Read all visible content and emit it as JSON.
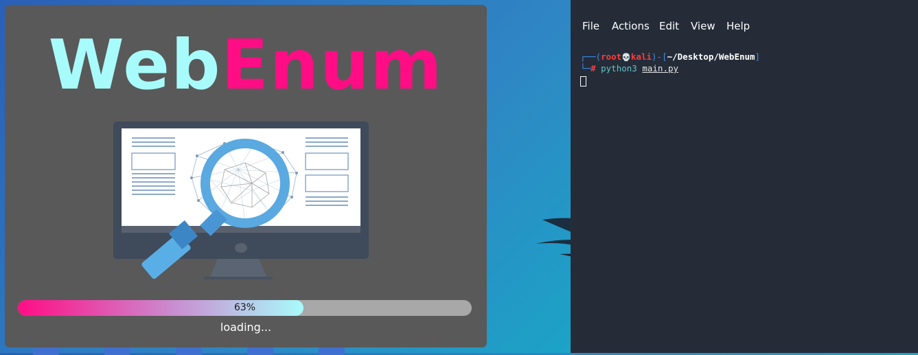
{
  "splash": {
    "logo_part1": "Web",
    "logo_part2": "Enum",
    "progress": {
      "percent": 63,
      "label": "63%"
    },
    "status": "loading..."
  },
  "terminal": {
    "menu": [
      "File",
      "Actions",
      "Edit",
      "View",
      "Help"
    ],
    "prompt": {
      "corner_top": "┌──(",
      "user": "root",
      "skull": "💀",
      "host": "kali",
      "bracket_mid": ")-[",
      "path": "~/Desktop/WebEnum",
      "bracket_end": "]",
      "corner_bottom": "└─",
      "hash": "#",
      "command": "python3",
      "argument": "main.py"
    }
  },
  "colors": {
    "logo_cyan": "#a8fbfb",
    "logo_pink": "#ff0d84",
    "splash_bg": "#595959",
    "terminal_bg": "#252c38"
  }
}
